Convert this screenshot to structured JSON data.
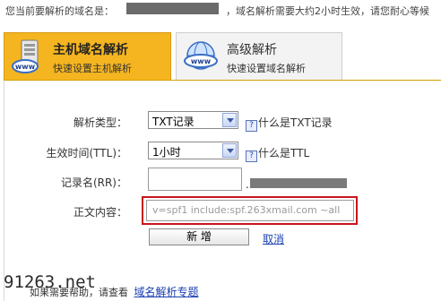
{
  "notice": {
    "prefix": "您当前要解析的域名是：",
    "suffix": "，域名解析需要大约2小时生效，请您耐心等候"
  },
  "tabs": [
    {
      "title": "主机域名解析",
      "subtitle": "快速设置主机解析",
      "icon": "www-server-icon"
    },
    {
      "title": "高级解析",
      "subtitle": "快速设置域名解析",
      "icon": "www-globe-icon"
    }
  ],
  "form": {
    "type_label": "解析类型：",
    "type_value": "TXT记录",
    "type_help": "什么是TXT记录",
    "ttl_label": "生效时间(TTL)：",
    "ttl_value": "1小时",
    "ttl_help": "什么是TTL",
    "rr_label": "记录名(RR)：",
    "rr_value": "",
    "rr_separator": ".",
    "content_label": "正文内容：",
    "content_value": "v=spf1 include:spf.263xmail.com ~all",
    "add_button": "新  增",
    "cancel_link": "取消"
  },
  "footer": {
    "text": "如果需要帮助，请查看",
    "link": "域名解析专题"
  },
  "watermark": "91263.net",
  "colors": {
    "active_tab": "#f5b520",
    "highlight_border": "#c8141e",
    "link": "#1a3fb0"
  }
}
